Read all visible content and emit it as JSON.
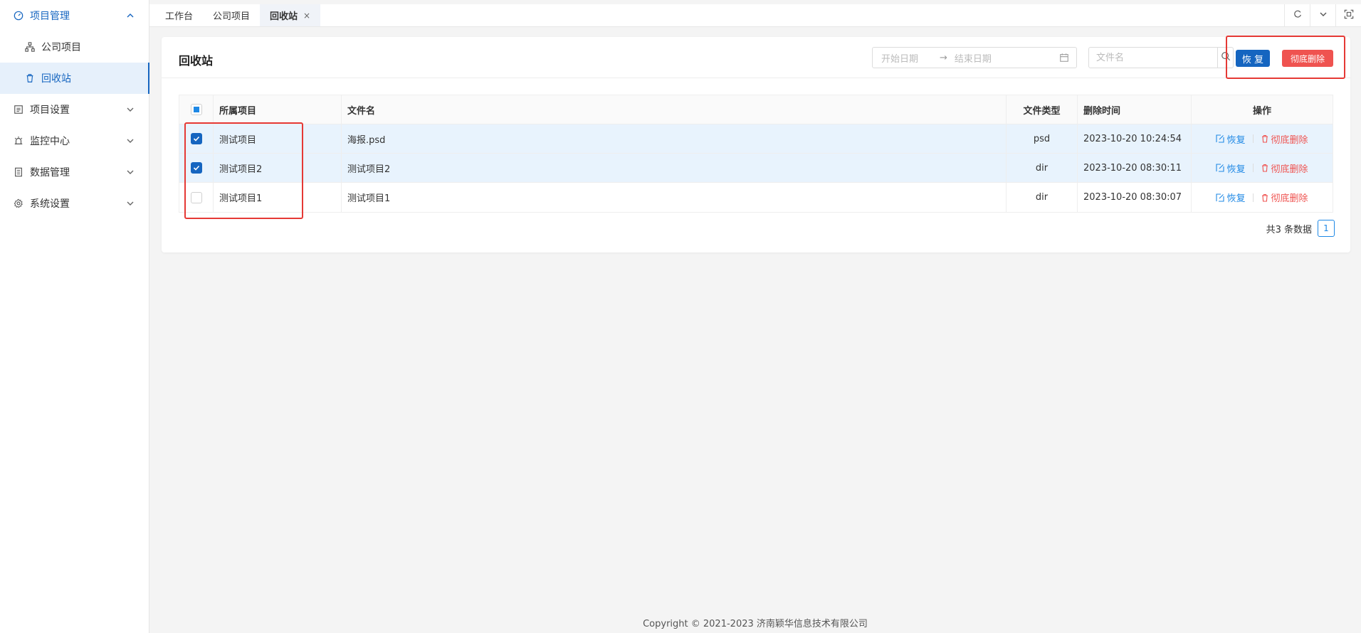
{
  "sidebar": {
    "items": [
      {
        "label": "项目管理",
        "icon": "dashboard-icon",
        "expanded": true
      },
      {
        "label": "公司项目",
        "icon": "sitemap-icon"
      },
      {
        "label": "回收站",
        "icon": "trash-icon",
        "selected": true
      },
      {
        "label": "项目设置",
        "icon": "settings-list-icon"
      },
      {
        "label": "监控中心",
        "icon": "alarm-icon"
      },
      {
        "label": "数据管理",
        "icon": "database-icon"
      },
      {
        "label": "系统设置",
        "icon": "gear-icon"
      }
    ]
  },
  "tabs": [
    {
      "label": "工作台"
    },
    {
      "label": "公司项目"
    },
    {
      "label": "回收站",
      "active": true,
      "close": "×"
    }
  ],
  "header": {
    "title": "回收站",
    "start_date_placeholder": "开始日期",
    "range_sep": "→",
    "end_date_placeholder": "结束日期",
    "search_placeholder": "文件名",
    "restore_label": "恢 复",
    "delete_label": "彻底删除"
  },
  "table": {
    "columns": [
      "所属项目",
      "文件名",
      "文件类型",
      "删除时间",
      "操作"
    ],
    "rows": [
      {
        "project": "测试项目",
        "name": "海报.psd",
        "type": "psd",
        "time": "2023-10-20 10:24:54",
        "checked": true
      },
      {
        "project": "测试项目2",
        "name": "测试项目2",
        "type": "dir",
        "time": "2023-10-20 08:30:11",
        "checked": true
      },
      {
        "project": "测试项目1",
        "name": "测试项目1",
        "type": "dir",
        "time": "2023-10-20 08:30:07",
        "checked": false
      }
    ],
    "op_restore": "恢复",
    "op_delete": "彻底删除"
  },
  "pager": {
    "total_text": "共3 条数据",
    "page": "1"
  },
  "footer": {
    "copyright": "Copyright © 2021-2023 济南颖华信息技术有限公司"
  },
  "colors": {
    "primary": "#1565c0",
    "danger": "#ef5350",
    "highlight": "#e53935"
  }
}
